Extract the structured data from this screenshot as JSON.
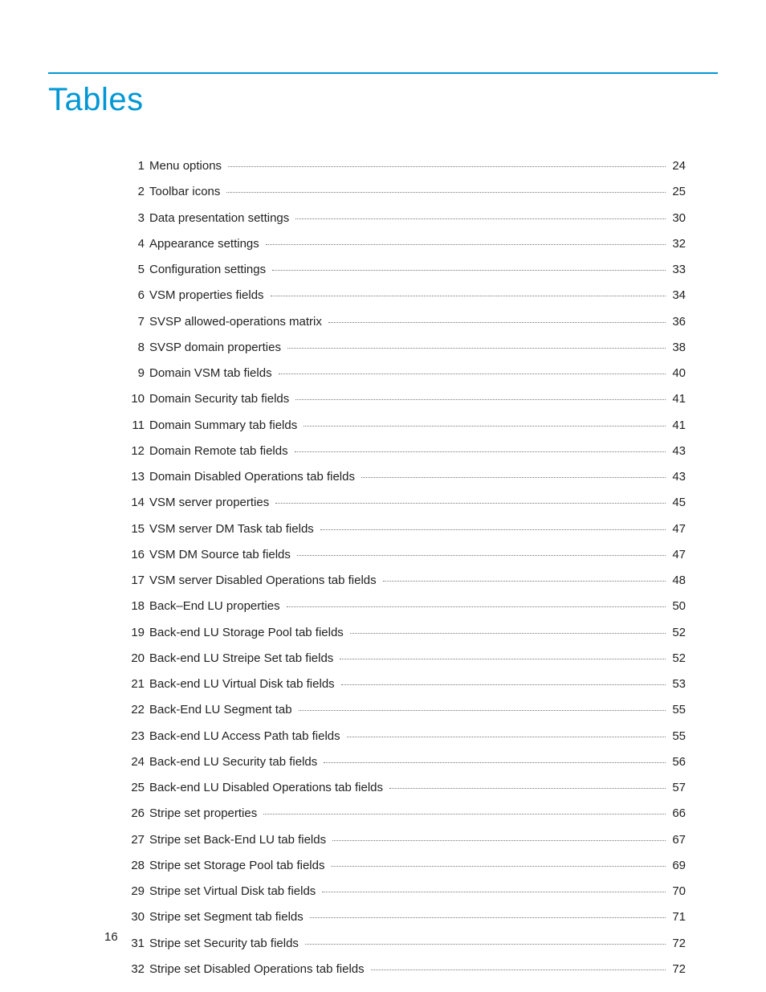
{
  "heading": "Tables",
  "page_number": "16",
  "toc": [
    {
      "n": "1",
      "label": "Menu options",
      "page": "24"
    },
    {
      "n": "2",
      "label": "Toolbar icons",
      "page": "25"
    },
    {
      "n": "3",
      "label": "Data presentation settings",
      "page": "30"
    },
    {
      "n": "4",
      "label": "Appearance settings",
      "page": "32"
    },
    {
      "n": "5",
      "label": "Configuration settings",
      "page": "33"
    },
    {
      "n": "6",
      "label": "VSM properties fields",
      "page": "34"
    },
    {
      "n": "7",
      "label": "SVSP allowed-operations matrix",
      "page": "36"
    },
    {
      "n": "8",
      "label": "SVSP domain properties",
      "page": "38"
    },
    {
      "n": "9",
      "label": "Domain VSM tab fields",
      "page": "40"
    },
    {
      "n": "10",
      "label": "Domain Security tab fields",
      "page": "41"
    },
    {
      "n": "11",
      "label": "Domain Summary tab fields",
      "page": "41"
    },
    {
      "n": "12",
      "label": "Domain Remote tab fields",
      "page": "43"
    },
    {
      "n": "13",
      "label": "Domain Disabled Operations tab fields",
      "page": "43"
    },
    {
      "n": "14",
      "label": "VSM server properties",
      "page": "45"
    },
    {
      "n": "15",
      "label": "VSM server DM Task tab fields",
      "page": "47"
    },
    {
      "n": "16",
      "label": "VSM DM Source tab fields",
      "page": "47"
    },
    {
      "n": "17",
      "label": "VSM server Disabled Operations tab fields",
      "page": "48"
    },
    {
      "n": "18",
      "label": "Back–End LU properties",
      "page": "50"
    },
    {
      "n": "19",
      "label": "Back-end LU Storage Pool tab fields",
      "page": "52"
    },
    {
      "n": "20",
      "label": "Back-end LU Streipe Set tab fields",
      "page": "52"
    },
    {
      "n": "21",
      "label": "Back-end LU Virtual Disk tab fields",
      "page": "53"
    },
    {
      "n": "22",
      "label": "Back-End LU Segment tab",
      "page": "55"
    },
    {
      "n": "23",
      "label": "Back-end LU Access Path tab fields",
      "page": "55"
    },
    {
      "n": "24",
      "label": "Back-end LU Security tab fields",
      "page": "56"
    },
    {
      "n": "25",
      "label": "Back-end LU Disabled Operations tab fields",
      "page": "57"
    },
    {
      "n": "26",
      "label": "Stripe set properties",
      "page": "66"
    },
    {
      "n": "27",
      "label": "Stripe set Back-End LU tab fields",
      "page": "67"
    },
    {
      "n": "28",
      "label": "Stripe set Storage Pool tab fields",
      "page": "69"
    },
    {
      "n": "29",
      "label": "Stripe set Virtual Disk tab fields",
      "page": "70"
    },
    {
      "n": "30",
      "label": "Stripe set Segment tab fields",
      "page": "71"
    },
    {
      "n": "31",
      "label": "Stripe set Security tab fields",
      "page": "72"
    },
    {
      "n": "32",
      "label": "Stripe set Disabled Operations tab fields",
      "page": "72"
    }
  ]
}
